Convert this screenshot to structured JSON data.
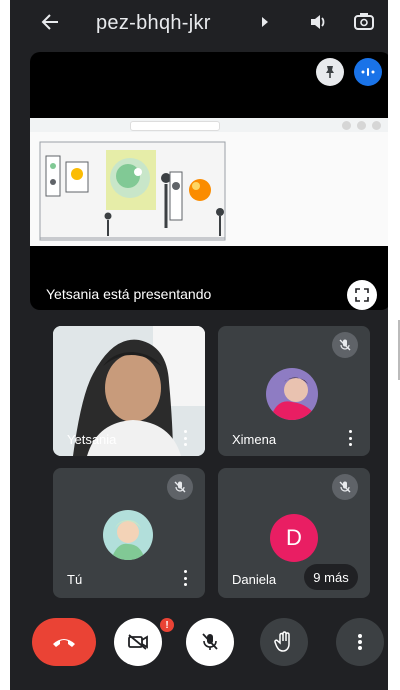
{
  "header": {
    "back_icon": "arrow-left-icon",
    "meeting_code": "pez-bhqh-jkr",
    "audio_icon": "speaker-icon",
    "camera_switch_icon": "switch-camera-icon"
  },
  "presentation": {
    "caption": "Yetsania está presentando",
    "pin_icon": "pin-icon",
    "speaking_icon": "audio-level-icon",
    "fullscreen_icon": "fullscreen-icon"
  },
  "participants": [
    {
      "name": "Yetsania",
      "muted": false,
      "has_video": true
    },
    {
      "name": "Ximena",
      "muted": true,
      "has_video": false
    },
    {
      "name": "Tú",
      "muted": true,
      "has_video": false
    },
    {
      "name": "Daniela",
      "muted": true,
      "has_video": false,
      "initial": "D",
      "avatar_color": "#e91e63"
    }
  ],
  "more_participants": "9 más",
  "controls": {
    "end_call_icon": "end-call-icon",
    "camera_icon": "camera-off-icon",
    "camera_badge": "!",
    "mic_icon": "mic-off-icon",
    "raise_hand_icon": "raise-hand-icon",
    "more_icon": "more-vert-icon"
  },
  "colors": {
    "background": "#202124",
    "tile": "#3c4043",
    "end_call": "#ea4335",
    "accent": "#1a73e8"
  }
}
